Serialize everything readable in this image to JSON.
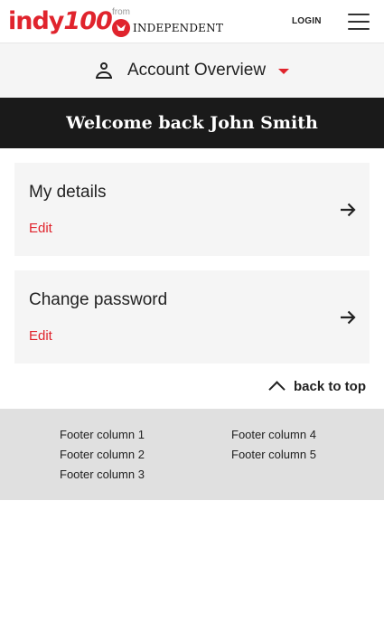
{
  "header": {
    "logo_word": "indy",
    "logo_number": "100",
    "from_label": "from",
    "partner": "INDEPENDENT",
    "login_label": "LOGIN"
  },
  "account_bar": {
    "title": "Account Overview"
  },
  "welcome": {
    "text": "Welcome back John Smith"
  },
  "cards": [
    {
      "title": "My details",
      "action": "Edit"
    },
    {
      "title": "Change password",
      "action": "Edit"
    }
  ],
  "back_to_top": {
    "label": "back to top"
  },
  "footer": {
    "left_columns": [
      "Footer column 1",
      "Footer column 2",
      "Footer column 3"
    ],
    "right_columns": [
      "Footer column 4",
      "Footer column 5"
    ]
  },
  "colors": {
    "brand_red": "#e0242d",
    "welcome_bg": "#1a1a1a",
    "card_bg": "#f5f5f5",
    "footer_bg": "#e0e0e0"
  }
}
